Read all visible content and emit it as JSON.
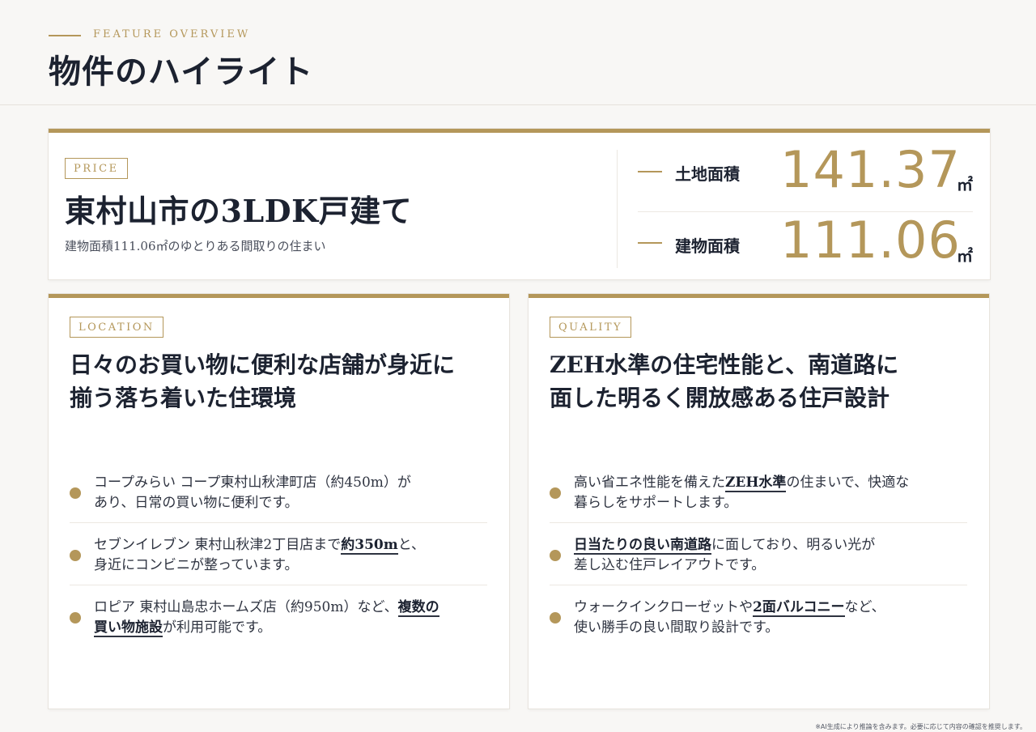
{
  "header": {
    "eyebrow": "FEATURE OVERVIEW",
    "title": "物件のハイライト"
  },
  "price_card": {
    "tag": "PRICE",
    "title": "東村山市の3LDK戸建て",
    "subtitle": "建物面積111.06㎡のゆとりある間取りの住まい",
    "stats": [
      {
        "label": "土地面積",
        "value": "141.37",
        "unit": "㎡"
      },
      {
        "label": "建物面積",
        "value": "111.06",
        "unit": "㎡"
      }
    ]
  },
  "location": {
    "tag": "LOCATION",
    "title_line1": "日々のお買い物に便利な店舗が身近に",
    "title_line2": "揃う落ち着いた住環境",
    "items": [
      {
        "pre": "コープみらい コープ東村山秋津町店（約450m）が",
        "line2": "あり、日常の買い物に便利です。"
      },
      {
        "pre": "セブンイレブン 東村山秋津2丁目店まで",
        "hl": "約350m",
        "post": "と、",
        "line2": "身近にコンビニが整っています。"
      },
      {
        "pre": "ロピア 東村山島忠ホームズ店（約950m）など、",
        "hl": "複数の",
        "hl2": "買い物施設",
        "post": "が利用可能です。"
      }
    ]
  },
  "quality": {
    "tag": "QUALITY",
    "title_line1": "ZEH水準の住宅性能と、南道路に",
    "title_line2": "面した明るく開放感ある住戸設計",
    "items": [
      {
        "pre": "高い省エネ性能を備えた",
        "hl": "ZEH水準",
        "post": "の住まいで、快適な",
        "line2": "暮らしをサポートします。"
      },
      {
        "hl": "日当たりの良い南道路",
        "post": "に面しており、明るい光が",
        "line2": "差し込む住戸レイアウトです。"
      },
      {
        "pre": "ウォークインクローゼットや",
        "hl": "2面バルコニー",
        "post": "など、",
        "line2": "使い勝手の良い間取り設計です。"
      }
    ]
  },
  "footnote": "※AI生成により推論を含みます。必要に応じて内容の確認を推奨します。",
  "colors": {
    "accent": "#b4975a",
    "navy": "#1c2230",
    "background": "#f8f7f5"
  }
}
